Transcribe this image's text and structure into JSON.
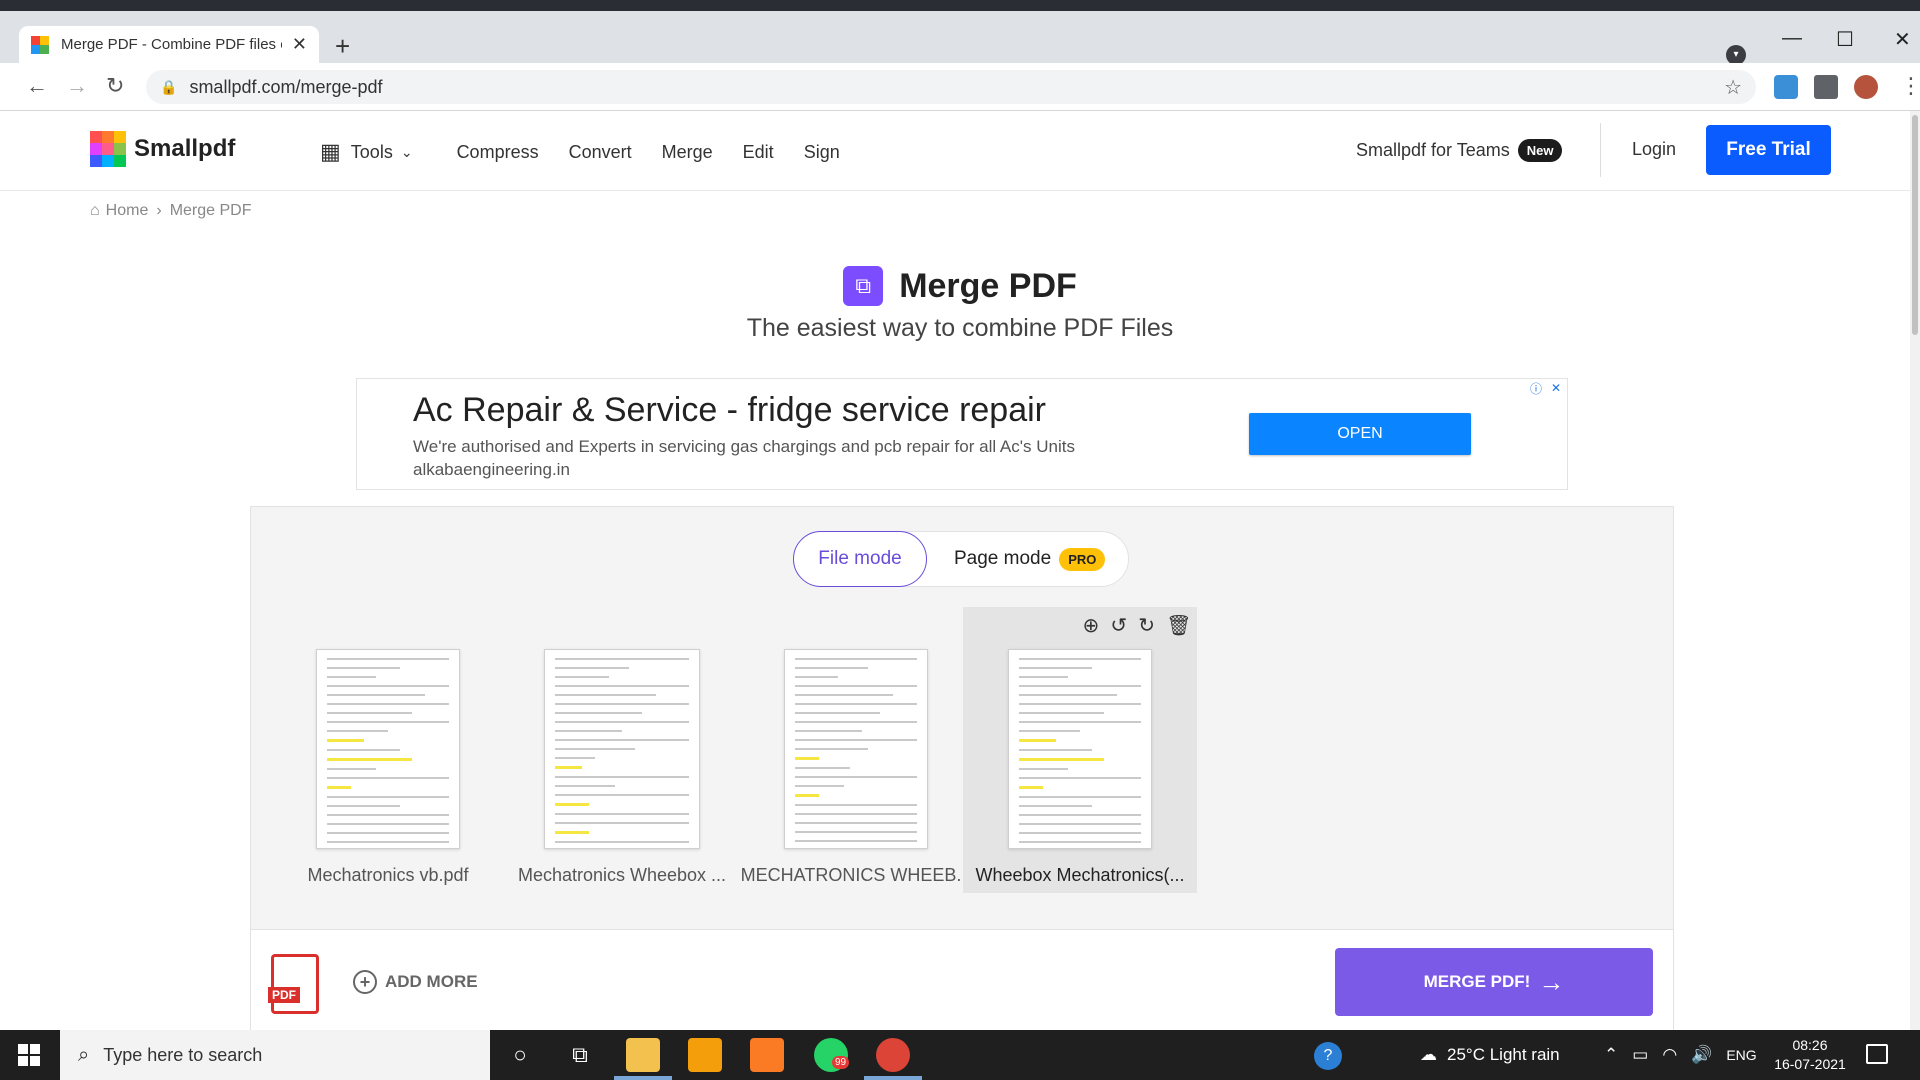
{
  "browser": {
    "tab_title": "Merge PDF - Combine PDF files o",
    "url": "smallpdf.com/merge-pdf",
    "new_tab": "+"
  },
  "header": {
    "brand": "Smallpdf",
    "tools_label": "Tools",
    "nav": [
      "Compress",
      "Convert",
      "Merge",
      "Edit",
      "Sign"
    ],
    "teams_label": "Smallpdf for Teams",
    "teams_badge": "New",
    "login": "Login",
    "free_trial": "Free Trial"
  },
  "breadcrumb": {
    "home": "Home",
    "separator": "›",
    "current": "Merge PDF"
  },
  "hero": {
    "title": "Merge PDF",
    "subtitle": "The easiest way to combine PDF Files"
  },
  "ad": {
    "title": "Ac Repair & Service - fridge service repair",
    "description": "We're authorised and Experts in servicing gas chargings and pcb repair for all Ac's Units",
    "url": "alkabaengineering.in",
    "cta": "OPEN"
  },
  "workspace": {
    "mode_file": "File mode",
    "mode_page": "Page mode",
    "pro_badge": "PRO",
    "files": [
      {
        "name": "Mechatronics vb.pdf",
        "selected": false
      },
      {
        "name": "Mechatronics Wheebox ...",
        "selected": false
      },
      {
        "name": "MECHATRONICS WHEEB...",
        "selected": false
      },
      {
        "name": "Wheebox Mechatronics(...",
        "selected": true
      }
    ],
    "add_more": "ADD MORE",
    "pdf_label": "PDF",
    "merge_button": "MERGE PDF!"
  },
  "taskbar": {
    "search_placeholder": "Type here to search",
    "whatsapp_badge": "99",
    "weather": "25°C  Light rain",
    "language": "ENG",
    "time": "08:26",
    "date": "16-07-2021"
  },
  "colors": {
    "brand_blue": "#0b5cff",
    "merge_purple": "#7c5ae8",
    "file_mode_accent": "#6a4cdb",
    "pro_yellow": "#ffc107",
    "ad_open_blue": "#0b84ff"
  }
}
